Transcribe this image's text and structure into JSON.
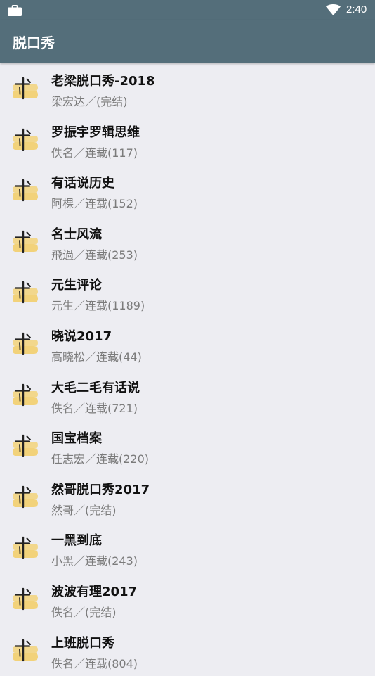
{
  "status_bar": {
    "time": "2:40",
    "icons": [
      "briefcase-icon",
      "wifi-icon"
    ]
  },
  "app_bar": {
    "title": "脱口秀"
  },
  "books": [
    {
      "title": "老梁脱口秀-2018",
      "meta": "梁宏达／(完结)"
    },
    {
      "title": "罗振宇罗辑思维",
      "meta": "佚名／连载(117)"
    },
    {
      "title": "有话说历史",
      "meta": "阿棵／连载(152)"
    },
    {
      "title": "名士风流",
      "meta": "飛過／连载(253)"
    },
    {
      "title": "元生评论",
      "meta": "元生／连载(1189)"
    },
    {
      "title": "晓说2017",
      "meta": "高晓松／连载(44)"
    },
    {
      "title": "大毛二毛有话说",
      "meta": "佚名／连载(721)"
    },
    {
      "title": "国宝档案",
      "meta": "任志宏／连载(220)"
    },
    {
      "title": "然哥脱口秀2017",
      "meta": "然哥／(完结)"
    },
    {
      "title": "一黑到底",
      "meta": "小黑／连载(243)"
    },
    {
      "title": "波波有理2017",
      "meta": "佚名／(完结)"
    },
    {
      "title": "上班脱口秀",
      "meta": "佚名／连载(804)"
    }
  ],
  "colors": {
    "app_bar": "#546e7a",
    "background": "#ededf2",
    "cover_accent": "#f2d27a"
  }
}
